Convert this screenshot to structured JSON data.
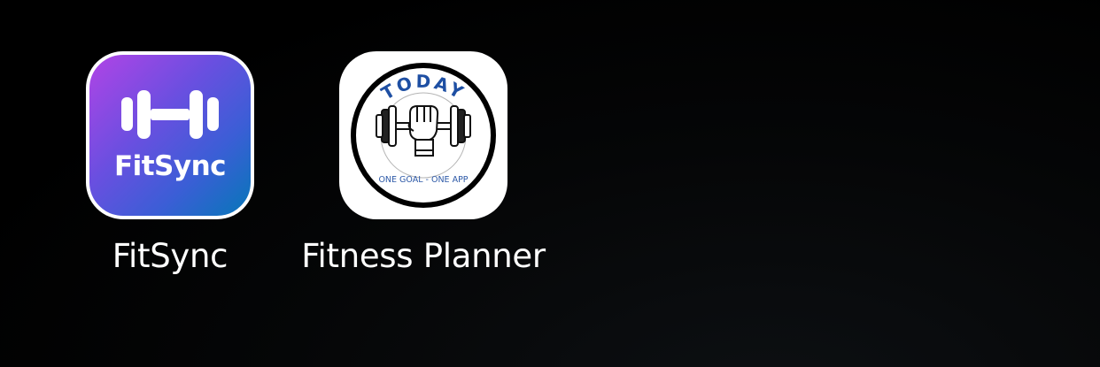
{
  "home_screen": {
    "apps": [
      {
        "label": "FitSync",
        "icon_wordmark": "FitSync",
        "icon_name": "dumbbell-icon",
        "colors": {
          "gradient_start": "#b144e6",
          "gradient_end": "#0677b8",
          "border": "#ffffff"
        }
      },
      {
        "label": "Fitness Planner",
        "icon_arc_text": "TODAY",
        "icon_tagline": "ONE GOAL - ONE APP",
        "icon_name": "fist-dumbbell-icon",
        "colors": {
          "arc_text": "#1e4fa3",
          "tagline": "#2e5aa8",
          "ring": "#000000",
          "background": "#ffffff"
        }
      }
    ]
  }
}
